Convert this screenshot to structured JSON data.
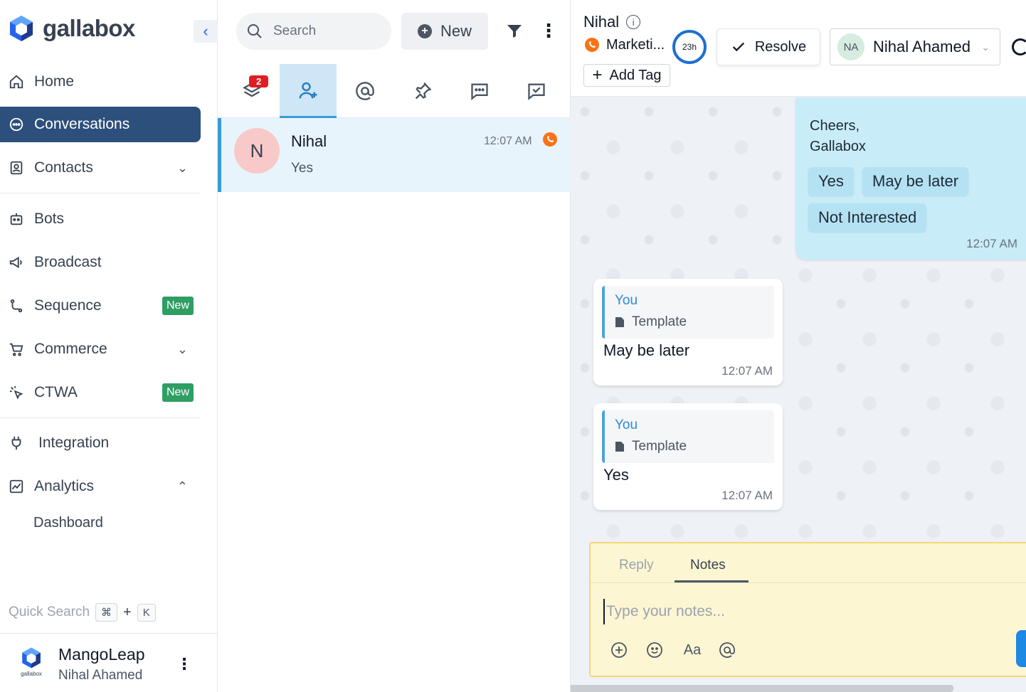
{
  "brand": {
    "name": "gallabox"
  },
  "sidebar": {
    "items": [
      {
        "label": "Home"
      },
      {
        "label": "Conversations"
      },
      {
        "label": "Contacts"
      },
      {
        "label": "Bots"
      },
      {
        "label": "Broadcast"
      },
      {
        "label": "Sequence",
        "badge": "New"
      },
      {
        "label": "Commerce"
      },
      {
        "label": "CTWA",
        "badge": "New"
      },
      {
        "label": "Integration"
      },
      {
        "label": "Analytics"
      }
    ],
    "analytics_sub": [
      "Dashboard"
    ],
    "quick_search": {
      "label": "Quick Search",
      "key1": "⌘",
      "plus": "+",
      "key2": "K"
    },
    "footer": {
      "org_name": "MangoLeap",
      "user_name": "Nihal Ahamed",
      "logo_text": "gallabox"
    }
  },
  "inbox": {
    "search_placeholder": "Search",
    "new_label": "New",
    "tabs": [
      {
        "icon": "stack-icon",
        "badge": "2"
      },
      {
        "icon": "user-plus-icon"
      },
      {
        "icon": "at-icon"
      },
      {
        "icon": "pin-icon"
      },
      {
        "icon": "chat-dots-icon"
      },
      {
        "icon": "chat-check-icon"
      }
    ],
    "conversations": [
      {
        "initial": "N",
        "name": "Nihal",
        "last_message": "Yes",
        "time": "12:07 AM"
      }
    ]
  },
  "chat": {
    "contact_name": "Nihal",
    "channel": "Marketi...",
    "timer": "23h",
    "resolve_label": "Resolve",
    "assignee": {
      "initials": "NA",
      "name": "Nihal Ahamed"
    },
    "add_tag_label": "Add Tag",
    "messages": {
      "outgoing": {
        "line1": "Cheers,",
        "line2": "Gallabox",
        "quick_replies": [
          "Yes",
          "May be later",
          "Not Interested"
        ],
        "time": "12:07 AM"
      },
      "incoming": [
        {
          "sender": "You",
          "quote_type": "Template",
          "text": "May be later",
          "time": "12:07 AM"
        },
        {
          "sender": "You",
          "quote_type": "Template",
          "text": "Yes",
          "time": "12:07 AM"
        }
      ]
    },
    "composer": {
      "tab_reply": "Reply",
      "tab_notes": "Notes",
      "placeholder": "Type your notes...",
      "format_label": "Aa"
    }
  },
  "colors": {
    "active_nav": "#2d4f7c",
    "badge_new": "#2f9e63",
    "accent": "#3b9ad9",
    "outgoing_bubble": "#c9ecf9",
    "notes_bg": "#fdf6d3"
  }
}
